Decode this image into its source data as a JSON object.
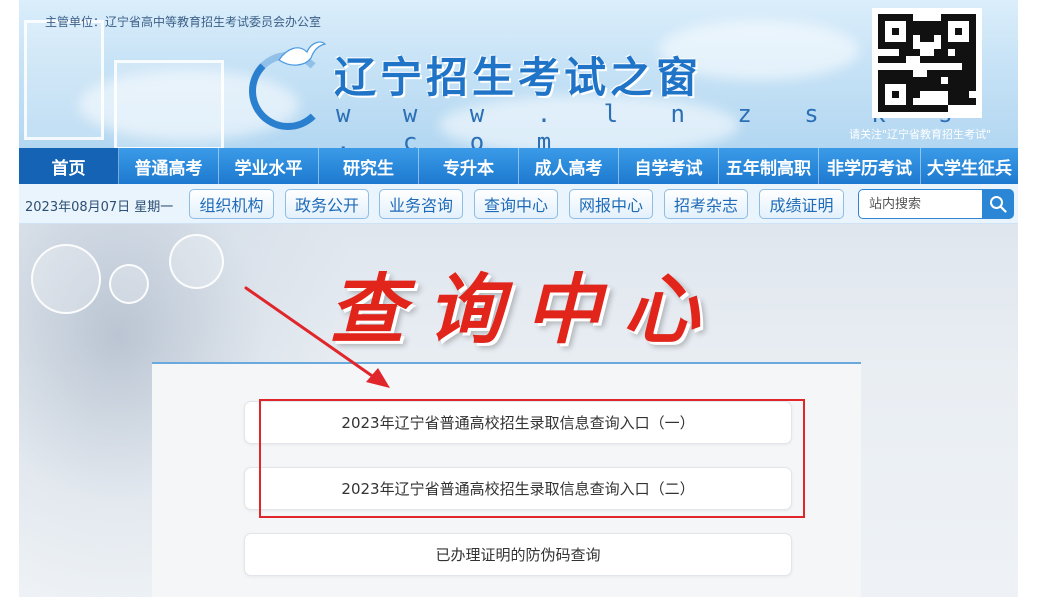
{
  "header": {
    "sponsor": "主管单位：辽宁省高中等教育招生考试委员会办公室",
    "site_title": "辽宁招生考试之窗",
    "site_url": "w w w . l n z s k s . c o m",
    "qr_note": "请关注\"辽宁省教育招生考试\""
  },
  "main_nav": {
    "items": [
      {
        "label": "首页",
        "active": true
      },
      {
        "label": "普通高考",
        "active": false
      },
      {
        "label": "学业水平",
        "active": false
      },
      {
        "label": "研究生",
        "active": false
      },
      {
        "label": "专升本",
        "active": false
      },
      {
        "label": "成人高考",
        "active": false
      },
      {
        "label": "自学考试",
        "active": false
      },
      {
        "label": "五年制高职",
        "active": false
      },
      {
        "label": "非学历考试",
        "active": false
      },
      {
        "label": "大学生征兵",
        "active": false
      }
    ]
  },
  "sub_nav": {
    "date": "2023年08月07日 星期一",
    "buttons": [
      "组织机构",
      "政务公开",
      "业务咨询",
      "查询中心",
      "网报中心",
      "招考杂志",
      "成绩证明"
    ],
    "search_placeholder": "站内搜索"
  },
  "hero": {
    "title": "查询中心"
  },
  "query_links": [
    {
      "label": "2023年辽宁省普通高校招生录取信息查询入口（一）"
    },
    {
      "label": "2023年辽宁省普通高校招生录取信息查询入口（二）"
    },
    {
      "label": "已办理证明的防伪码查询"
    }
  ],
  "colors": {
    "nav_blue": "#1d79cf",
    "nav_active": "#1463b5",
    "title_red": "#e1251b",
    "highlight_red": "#e0262b"
  },
  "icons": {
    "search": "search-icon",
    "logo": "dove-logo-icon",
    "qr": "qr-code"
  }
}
